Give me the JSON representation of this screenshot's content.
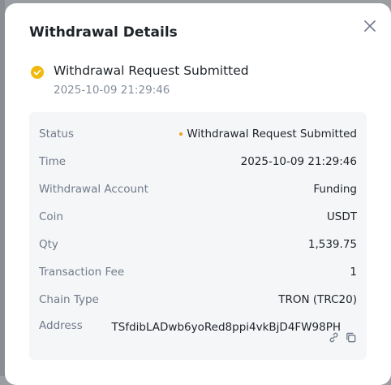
{
  "modal": {
    "title": "Withdrawal Details"
  },
  "status_header": {
    "title": "Withdrawal Request Submitted",
    "timestamp": "2025-10-09 21:29:46",
    "icon": "check-circle-icon",
    "accent_color": "#f0b90b"
  },
  "details": {
    "status": {
      "label": "Status",
      "value": "Withdrawal Request Submitted",
      "dot_color": "#f0a020"
    },
    "time": {
      "label": "Time",
      "value": "2025-10-09 21:29:46"
    },
    "account": {
      "label": "Withdrawal Account",
      "value": "Funding"
    },
    "coin": {
      "label": "Coin",
      "value": "USDT"
    },
    "qty": {
      "label": "Qty",
      "value": "1,539.75"
    },
    "fee": {
      "label": "Transaction Fee",
      "value": "1"
    },
    "chain": {
      "label": "Chain Type",
      "value": "TRON (TRC20)"
    },
    "address": {
      "label": "Address",
      "value": "TSfdibLADwb6yoRed8ppi4vkBjD4FW98PH"
    }
  },
  "icons": {
    "close": "close-icon",
    "link": "link-icon",
    "copy": "copy-icon"
  }
}
